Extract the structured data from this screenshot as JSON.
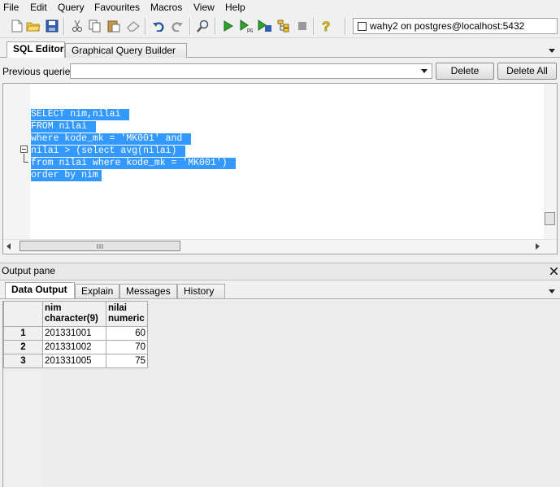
{
  "menu": [
    "File",
    "Edit",
    "Query",
    "Favourites",
    "Macros",
    "View",
    "Help"
  ],
  "toolbar": {
    "icons": [
      "new-icon",
      "open-icon",
      "save-icon",
      "cut-icon",
      "copy-icon",
      "paste-icon",
      "clear-icon",
      "undo-icon",
      "redo-icon",
      "find-icon",
      "execute-icon",
      "execute-pgscript-icon",
      "execute-to-file-icon",
      "explain-icon",
      "cancel-icon",
      "help-icon"
    ],
    "connection": "wahy2 on postgres@localhost:5432"
  },
  "editor_tabs": [
    "SQL Editor",
    "Graphical Query Builder"
  ],
  "previous_queries_label": "Previous queries",
  "delete_label": "Delete",
  "delete_all_label": "Delete All",
  "sql": {
    "lines": [
      "SELECT nim,nilai ",
      "FROM nilai ",
      "where kode_mk = 'MK001' and ",
      "nilai > (select avg(nilai) ",
      "from nilai where kode_mk = 'MK001') ",
      "order by nim"
    ]
  },
  "output": {
    "title": "Output pane",
    "tabs": [
      "Data Output",
      "Explain",
      "Messages",
      "History"
    ],
    "columns": [
      {
        "name": "nim",
        "type": "character(9)"
      },
      {
        "name": "nilai",
        "type": "numeric"
      }
    ],
    "rows": [
      {
        "n": "1",
        "nim": "201331001",
        "nilai": "60"
      },
      {
        "n": "2",
        "nim": "201331002",
        "nilai": "70"
      },
      {
        "n": "3",
        "nim": "201331005",
        "nilai": "75"
      }
    ]
  },
  "colors": {
    "selection": "#3399ff",
    "accent": "#3399ff"
  }
}
